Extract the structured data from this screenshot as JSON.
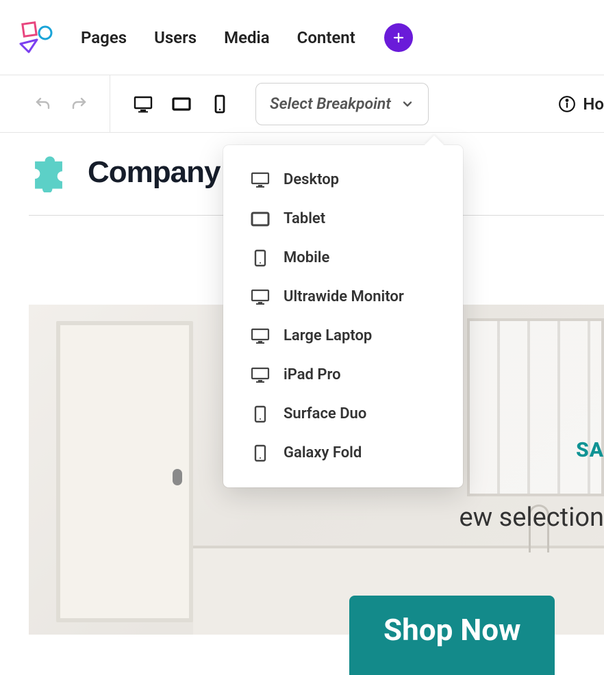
{
  "nav": {
    "items": [
      "Pages",
      "Users",
      "Media",
      "Content"
    ]
  },
  "toolbar": {
    "breakpoint_placeholder": "Select Breakpoint",
    "right_label": "Ho"
  },
  "dropdown": {
    "items": [
      {
        "label": "Desktop",
        "icon": "desktop"
      },
      {
        "label": "Tablet",
        "icon": "tablet"
      },
      {
        "label": "Mobile",
        "icon": "mobile"
      },
      {
        "label": "Ultrawide Monitor",
        "icon": "desktop"
      },
      {
        "label": "Large Laptop",
        "icon": "desktop"
      },
      {
        "label": "iPad Pro",
        "icon": "desktop"
      },
      {
        "label": "Surface Duo",
        "icon": "mobile"
      },
      {
        "label": "Galaxy Fold",
        "icon": "mobile"
      }
    ]
  },
  "canvas": {
    "company_name": "Company ",
    "sale_tag": "SA",
    "selection_text": "ew selection",
    "shop_now": "Shop Now"
  }
}
